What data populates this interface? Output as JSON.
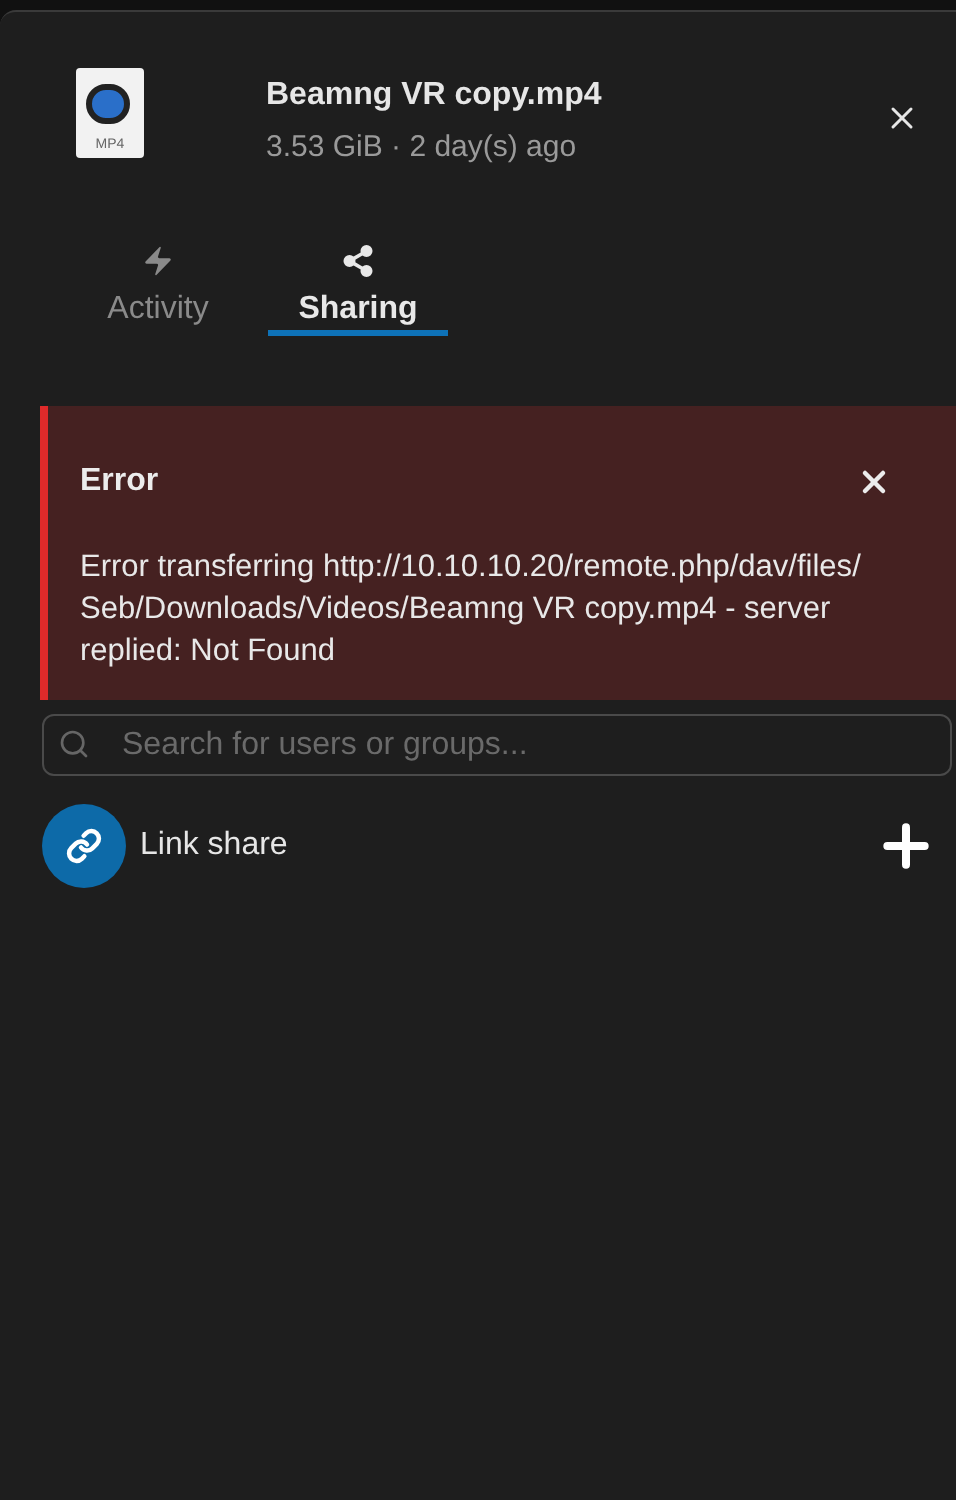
{
  "file": {
    "icon_label": "MP4",
    "name": "Beamng VR copy.mp4",
    "details": "3.53 GiB · 2 day(s) ago"
  },
  "tabs": [
    {
      "label": "Activity",
      "kind": "activity",
      "selected": false
    },
    {
      "label": "Sharing",
      "kind": "sharing",
      "selected": true
    }
  ],
  "error": {
    "title": "Error",
    "message": "Error transferring http://10.10.10.20/remote.php/dav/files/Seb/Downloads/Videos/Beamng VR copy.mp4 - server replied: Not Found"
  },
  "search": {
    "placeholder": "Search for users or groups..."
  },
  "link_share": {
    "label": "Link share"
  }
}
